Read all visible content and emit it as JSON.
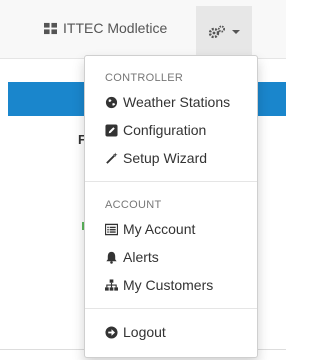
{
  "navbar": {
    "brand_label": "ITTEC Modletice",
    "brand_icon": "grid-icon",
    "menu_icon": "gears-icon"
  },
  "background": {
    "stub_text": "F"
  },
  "dropdown": {
    "sections": [
      {
        "header": "CONTROLLER",
        "items": [
          {
            "label": "Weather Stations",
            "icon": "globe-icon"
          },
          {
            "label": "Configuration",
            "icon": "edit-icon"
          },
          {
            "label": "Setup Wizard",
            "icon": "magic-wand-icon"
          }
        ]
      },
      {
        "header": "ACCOUNT",
        "items": [
          {
            "label": "My Account",
            "icon": "list-alt-icon"
          },
          {
            "label": "Alerts",
            "icon": "bell-icon"
          },
          {
            "label": "My Customers",
            "icon": "sitemap-icon"
          }
        ]
      }
    ],
    "logout_label": "Logout",
    "logout_icon": "circle-arrow-right-icon"
  },
  "colors": {
    "accent": "#1a86cc",
    "navbar_bg": "#f8f8f8",
    "toggle_bg": "#e7e7e7"
  }
}
